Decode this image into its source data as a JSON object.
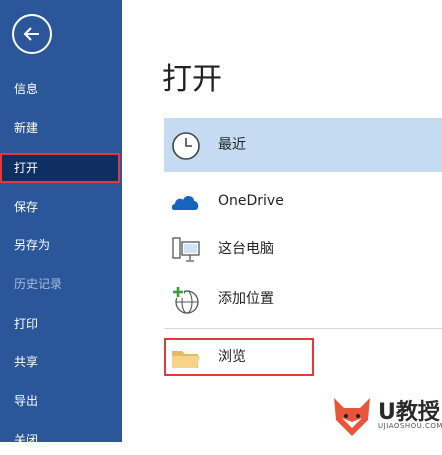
{
  "nav": {
    "items": [
      {
        "label": "信息"
      },
      {
        "label": "新建"
      },
      {
        "label": "打开"
      },
      {
        "label": "保存"
      },
      {
        "label": "另存为"
      },
      {
        "label": "历史记录"
      },
      {
        "label": "打印"
      },
      {
        "label": "共享"
      },
      {
        "label": "导出"
      },
      {
        "label": "关闭"
      }
    ],
    "active": "打开",
    "disabled": "历史记录"
  },
  "main": {
    "title": "打开",
    "locations": [
      {
        "label": "最近",
        "icon": "clock-icon",
        "selected": true
      },
      {
        "label": "OneDrive",
        "icon": "cloud-icon"
      },
      {
        "label": "这台电脑",
        "icon": "computer-icon"
      },
      {
        "label": "添加位置",
        "icon": "globe-add-icon"
      },
      {
        "label": "浏览",
        "icon": "folder-icon",
        "highlighted": true
      }
    ]
  },
  "watermark": {
    "text": "U教授",
    "subtext": "UJIAOSHOU.COM"
  },
  "colors": {
    "nav_bg": "#2b579a",
    "selected_bg": "#c5dbf1",
    "highlight": "#e0393e"
  }
}
